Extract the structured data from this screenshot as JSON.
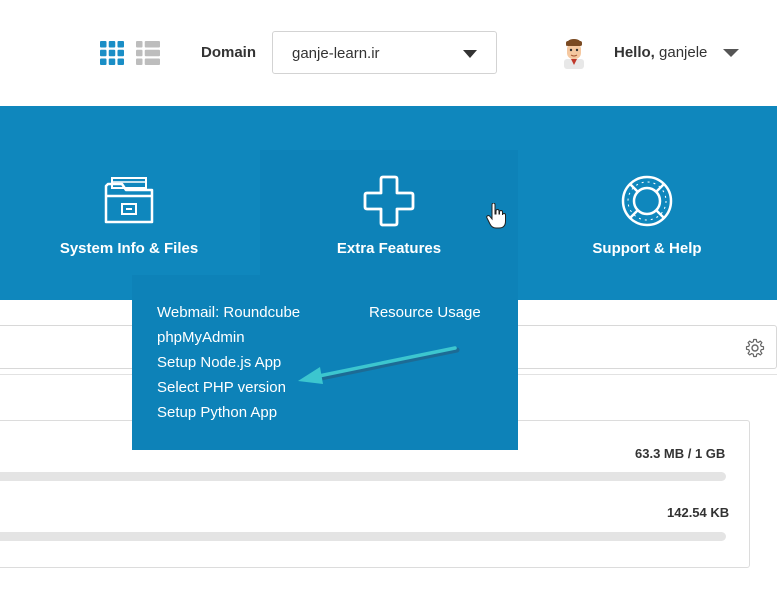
{
  "header": {
    "grid_view_icon": "grid-view-icon",
    "list_view_icon": "list-view-icon",
    "domain_label": "Domain",
    "domain_value": "ganje-learn.ir",
    "greeting": "Hello,",
    "username": "ganjele"
  },
  "nav": {
    "items": [
      {
        "label": "System Info & Files",
        "icon": "folder-icon"
      },
      {
        "label": "Extra Features",
        "icon": "plus-icon"
      },
      {
        "label": "Support & Help",
        "icon": "lifebuoy-icon"
      }
    ]
  },
  "dropdown": {
    "col1": [
      "Webmail: Roundcube",
      "phpMyAdmin",
      "Setup Node.js App",
      "Select PHP version",
      "Setup Python App"
    ],
    "col2": [
      "Resource Usage"
    ]
  },
  "stats": {
    "disk_usage": "63.3 MB / 1 GB",
    "bandwidth": "142.54 KB"
  },
  "colors": {
    "accent_blue": "#0f87bd",
    "arrow": "#3cc6cf"
  }
}
